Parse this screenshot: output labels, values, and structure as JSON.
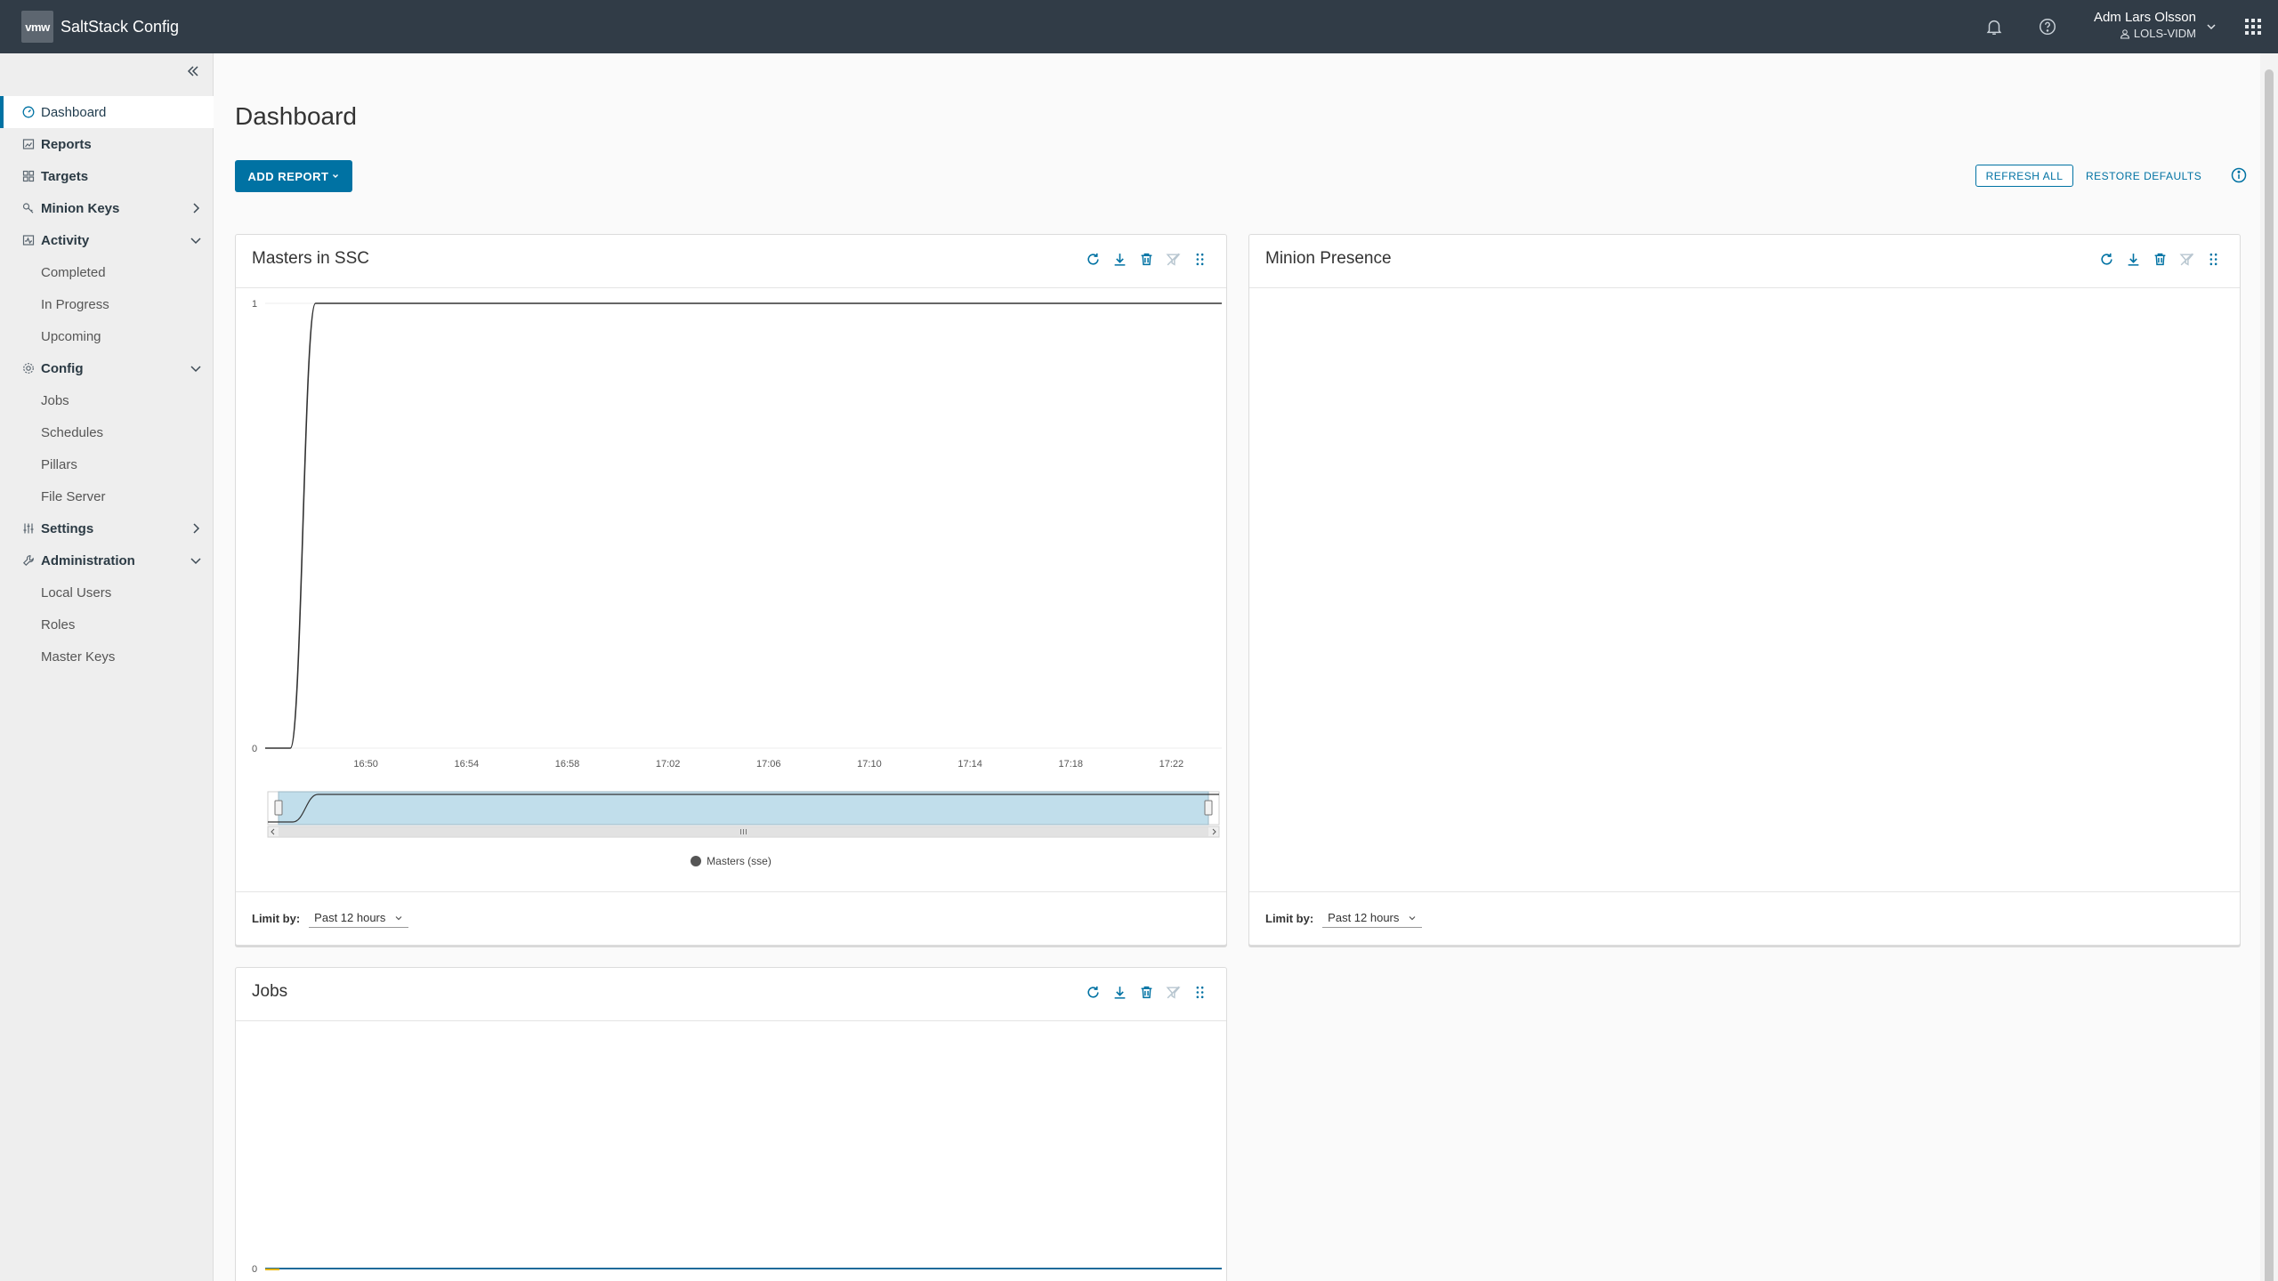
{
  "header": {
    "logo": "vmw",
    "app_title": "SaltStack Config",
    "user_name": "Adm Lars Olsson",
    "user_domain": "LOLS-VIDM",
    "icons": [
      "bell-icon",
      "help-icon",
      "user-icon",
      "chevron-down-icon",
      "app-grid-icon"
    ]
  },
  "sidebar": {
    "items": [
      {
        "label": "Dashboard",
        "icon": "dashboard-icon",
        "active": true
      },
      {
        "label": "Reports",
        "icon": "reports-icon"
      },
      {
        "label": "Targets",
        "icon": "targets-icon"
      },
      {
        "label": "Minion Keys",
        "icon": "key-icon",
        "expandable": "right"
      },
      {
        "label": "Activity",
        "icon": "activity-icon",
        "expandable": "down"
      },
      {
        "label": "Completed",
        "sub": true
      },
      {
        "label": "In Progress",
        "sub": true
      },
      {
        "label": "Upcoming",
        "sub": true
      },
      {
        "label": "Config",
        "icon": "gear-icon",
        "expandable": "down"
      },
      {
        "label": "Jobs",
        "sub": true
      },
      {
        "label": "Schedules",
        "sub": true
      },
      {
        "label": "Pillars",
        "sub": true
      },
      {
        "label": "File Server",
        "sub": true
      },
      {
        "label": "Settings",
        "icon": "sliders-icon",
        "expandable": "right"
      },
      {
        "label": "Administration",
        "icon": "wrench-icon",
        "expandable": "down"
      },
      {
        "label": "Local Users",
        "sub": true
      },
      {
        "label": "Roles",
        "sub": true
      },
      {
        "label": "Master Keys",
        "sub": true
      }
    ]
  },
  "main": {
    "title": "Dashboard",
    "add_report": "ADD REPORT",
    "refresh_all": "REFRESH ALL",
    "restore_defaults": "RESTORE DEFAULTS",
    "cards": [
      {
        "title": "Masters in SSC",
        "limit_label": "Limit by:",
        "limit_value": "Past 12 hours",
        "legend": "Masters (sse)"
      },
      {
        "title": "Minion Presence",
        "limit_label": "Limit by:",
        "limit_value": "Past 12 hours"
      },
      {
        "title": "Jobs"
      }
    ]
  },
  "colors": {
    "header_bg": "#313c47",
    "accent": "#0072a3",
    "navigator_fill": "#b6d8e8",
    "line": "#333333"
  },
  "chart_data": [
    {
      "type": "line",
      "title": "Masters in SSC",
      "x": [
        "16:46",
        "16:47",
        "16:48",
        "16:50",
        "16:54",
        "16:58",
        "17:02",
        "17:06",
        "17:10",
        "17:14",
        "17:18",
        "17:22",
        "17:24"
      ],
      "x_ticks": [
        "16:50",
        "16:54",
        "16:58",
        "17:02",
        "17:06",
        "17:10",
        "17:14",
        "17:18",
        "17:22"
      ],
      "series": [
        {
          "name": "Masters (sse)",
          "values": [
            0,
            0,
            1,
            1,
            1,
            1,
            1,
            1,
            1,
            1,
            1,
            1,
            1
          ]
        }
      ],
      "y_ticks": [
        "0",
        "1"
      ],
      "ylim": [
        0,
        1
      ],
      "legend": "bottom-center"
    },
    {
      "type": "line",
      "title": "Jobs",
      "y_ticks": [
        "0"
      ]
    }
  ]
}
